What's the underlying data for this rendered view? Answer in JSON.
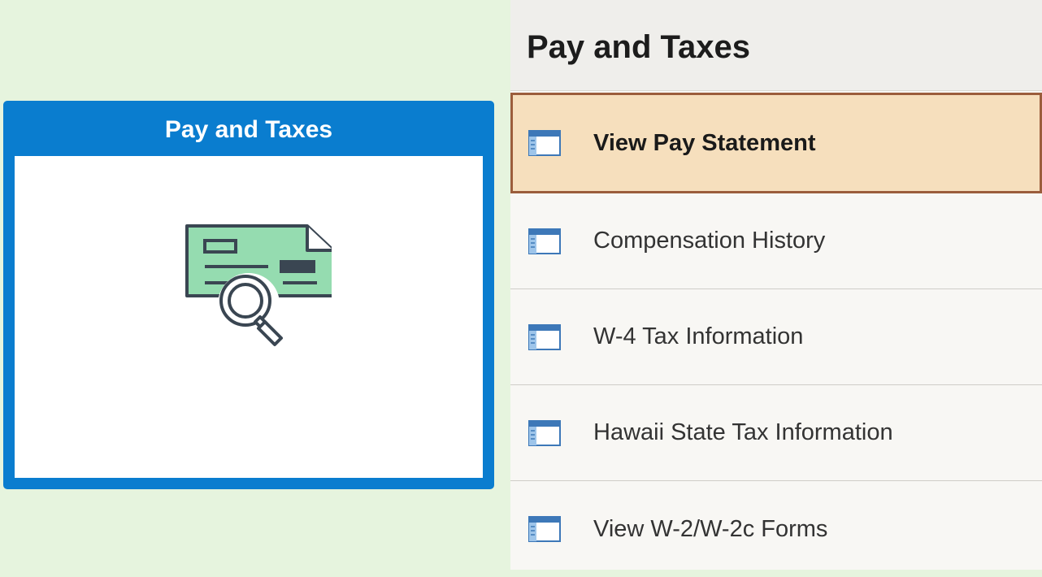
{
  "tile": {
    "title": "Pay and Taxes",
    "icon": "paycheck-magnifier-icon",
    "header_color": "#0a7dcf"
  },
  "panel": {
    "title": "Pay and Taxes",
    "items": [
      {
        "label": "View Pay Statement",
        "icon": "page-icon",
        "selected": true
      },
      {
        "label": "Compensation History",
        "icon": "page-icon",
        "selected": false
      },
      {
        "label": "W-4 Tax Information",
        "icon": "page-icon",
        "selected": false
      },
      {
        "label": "Hawaii State Tax Information",
        "icon": "page-icon",
        "selected": false
      },
      {
        "label": "View W-2/W-2c Forms",
        "icon": "page-icon",
        "selected": false
      }
    ]
  },
  "colors": {
    "background": "#e6f4de",
    "selected_item_bg": "#f6dfbd",
    "selected_item_border": "#9b5d3c"
  }
}
